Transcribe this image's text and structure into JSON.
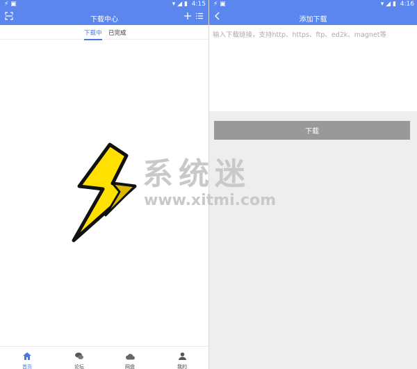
{
  "left_screen": {
    "status": {
      "icons_left": "⚡ ▣",
      "time": "4:15"
    },
    "title": "下载中心",
    "tabs": [
      {
        "label": "下载中"
      },
      {
        "label": "已完成"
      }
    ],
    "bottom_nav": [
      {
        "label": "首页",
        "icon": "home-icon"
      },
      {
        "label": "论坛",
        "icon": "chat-icon"
      },
      {
        "label": "网盘",
        "icon": "cloud-icon"
      },
      {
        "label": "我的",
        "icon": "person-icon"
      }
    ]
  },
  "right_screen": {
    "status": {
      "icons_left": "⚡ ▣",
      "time": "4:16"
    },
    "title": "添加下载",
    "input_placeholder": "输入下载链接，支持http、https、ftp、ed2k、magnet等",
    "download_button": "下载"
  },
  "watermark": {
    "chinese": "系统迷",
    "url": "www.xitmi.com"
  },
  "colors": {
    "header": "#5b86ee",
    "accent": "#4a76e3",
    "button": "#999999",
    "panel": "#eeeeee"
  }
}
